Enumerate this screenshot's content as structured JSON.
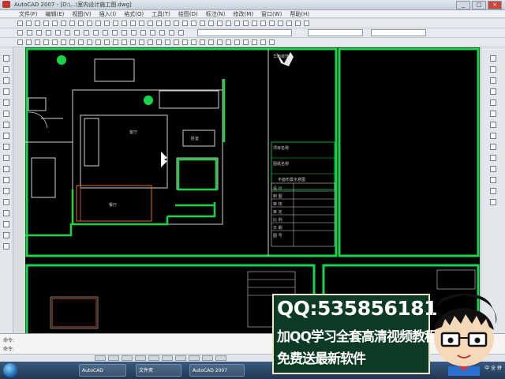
{
  "window": {
    "title": "AutoCAD 2007 - [D:\\...\\室内设计施工图.dwg]",
    "min": "_",
    "max": "□",
    "close": "×"
  },
  "menu": [
    "文件(F)",
    "编辑(E)",
    "视图(V)",
    "插入(I)",
    "格式(O)",
    "工具(T)",
    "绘图(D)",
    "标注(N)",
    "修改(M)",
    "窗口(W)",
    "帮助(H)"
  ],
  "drawing": {
    "logo_text": "华南装饰",
    "title_block_labels": [
      "项目名称",
      "图纸名称",
      "平面布置示意图",
      "设 计",
      "制 图",
      "审 核",
      "审 定",
      "比 例",
      "日 期",
      "图 号"
    ],
    "room_labels": [
      "客厅",
      "餐厅",
      "卧室"
    ]
  },
  "command": {
    "line1": "命令:",
    "line2": "命令:"
  },
  "taskbar": {
    "task1": "AutoCAD",
    "task2": "文件夹",
    "task3": "AutoCAD 2007",
    "tray": "中 全 拼"
  },
  "promo": {
    "qq": "QQ:535856181",
    "line1": "加QQ学习全套高清视频教程",
    "line2": "免费送最新软件"
  },
  "colors": {
    "canvas_bg": "#000000",
    "frame_green": "#17d44b",
    "line_white": "#d0d0d0",
    "promo_bg": "#0c3a25"
  }
}
